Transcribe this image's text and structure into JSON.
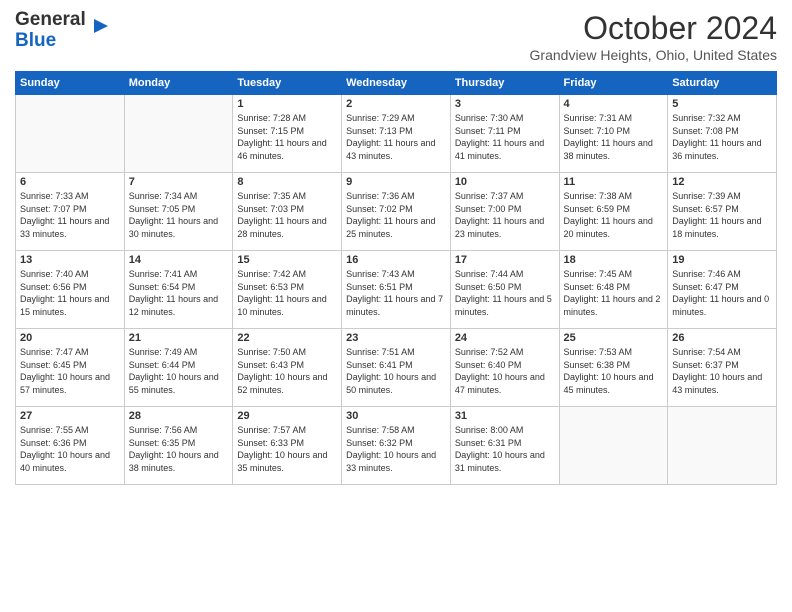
{
  "header": {
    "logo_line1": "General",
    "logo_line2": "Blue",
    "month_title": "October 2024",
    "location": "Grandview Heights, Ohio, United States"
  },
  "weekdays": [
    "Sunday",
    "Monday",
    "Tuesday",
    "Wednesday",
    "Thursday",
    "Friday",
    "Saturday"
  ],
  "weeks": [
    [
      {
        "day": "",
        "sunrise": "",
        "sunset": "",
        "daylight": ""
      },
      {
        "day": "",
        "sunrise": "",
        "sunset": "",
        "daylight": ""
      },
      {
        "day": "1",
        "sunrise": "Sunrise: 7:28 AM",
        "sunset": "Sunset: 7:15 PM",
        "daylight": "Daylight: 11 hours and 46 minutes."
      },
      {
        "day": "2",
        "sunrise": "Sunrise: 7:29 AM",
        "sunset": "Sunset: 7:13 PM",
        "daylight": "Daylight: 11 hours and 43 minutes."
      },
      {
        "day": "3",
        "sunrise": "Sunrise: 7:30 AM",
        "sunset": "Sunset: 7:11 PM",
        "daylight": "Daylight: 11 hours and 41 minutes."
      },
      {
        "day": "4",
        "sunrise": "Sunrise: 7:31 AM",
        "sunset": "Sunset: 7:10 PM",
        "daylight": "Daylight: 11 hours and 38 minutes."
      },
      {
        "day": "5",
        "sunrise": "Sunrise: 7:32 AM",
        "sunset": "Sunset: 7:08 PM",
        "daylight": "Daylight: 11 hours and 36 minutes."
      }
    ],
    [
      {
        "day": "6",
        "sunrise": "Sunrise: 7:33 AM",
        "sunset": "Sunset: 7:07 PM",
        "daylight": "Daylight: 11 hours and 33 minutes."
      },
      {
        "day": "7",
        "sunrise": "Sunrise: 7:34 AM",
        "sunset": "Sunset: 7:05 PM",
        "daylight": "Daylight: 11 hours and 30 minutes."
      },
      {
        "day": "8",
        "sunrise": "Sunrise: 7:35 AM",
        "sunset": "Sunset: 7:03 PM",
        "daylight": "Daylight: 11 hours and 28 minutes."
      },
      {
        "day": "9",
        "sunrise": "Sunrise: 7:36 AM",
        "sunset": "Sunset: 7:02 PM",
        "daylight": "Daylight: 11 hours and 25 minutes."
      },
      {
        "day": "10",
        "sunrise": "Sunrise: 7:37 AM",
        "sunset": "Sunset: 7:00 PM",
        "daylight": "Daylight: 11 hours and 23 minutes."
      },
      {
        "day": "11",
        "sunrise": "Sunrise: 7:38 AM",
        "sunset": "Sunset: 6:59 PM",
        "daylight": "Daylight: 11 hours and 20 minutes."
      },
      {
        "day": "12",
        "sunrise": "Sunrise: 7:39 AM",
        "sunset": "Sunset: 6:57 PM",
        "daylight": "Daylight: 11 hours and 18 minutes."
      }
    ],
    [
      {
        "day": "13",
        "sunrise": "Sunrise: 7:40 AM",
        "sunset": "Sunset: 6:56 PM",
        "daylight": "Daylight: 11 hours and 15 minutes."
      },
      {
        "day": "14",
        "sunrise": "Sunrise: 7:41 AM",
        "sunset": "Sunset: 6:54 PM",
        "daylight": "Daylight: 11 hours and 12 minutes."
      },
      {
        "day": "15",
        "sunrise": "Sunrise: 7:42 AM",
        "sunset": "Sunset: 6:53 PM",
        "daylight": "Daylight: 11 hours and 10 minutes."
      },
      {
        "day": "16",
        "sunrise": "Sunrise: 7:43 AM",
        "sunset": "Sunset: 6:51 PM",
        "daylight": "Daylight: 11 hours and 7 minutes."
      },
      {
        "day": "17",
        "sunrise": "Sunrise: 7:44 AM",
        "sunset": "Sunset: 6:50 PM",
        "daylight": "Daylight: 11 hours and 5 minutes."
      },
      {
        "day": "18",
        "sunrise": "Sunrise: 7:45 AM",
        "sunset": "Sunset: 6:48 PM",
        "daylight": "Daylight: 11 hours and 2 minutes."
      },
      {
        "day": "19",
        "sunrise": "Sunrise: 7:46 AM",
        "sunset": "Sunset: 6:47 PM",
        "daylight": "Daylight: 11 hours and 0 minutes."
      }
    ],
    [
      {
        "day": "20",
        "sunrise": "Sunrise: 7:47 AM",
        "sunset": "Sunset: 6:45 PM",
        "daylight": "Daylight: 10 hours and 57 minutes."
      },
      {
        "day": "21",
        "sunrise": "Sunrise: 7:49 AM",
        "sunset": "Sunset: 6:44 PM",
        "daylight": "Daylight: 10 hours and 55 minutes."
      },
      {
        "day": "22",
        "sunrise": "Sunrise: 7:50 AM",
        "sunset": "Sunset: 6:43 PM",
        "daylight": "Daylight: 10 hours and 52 minutes."
      },
      {
        "day": "23",
        "sunrise": "Sunrise: 7:51 AM",
        "sunset": "Sunset: 6:41 PM",
        "daylight": "Daylight: 10 hours and 50 minutes."
      },
      {
        "day": "24",
        "sunrise": "Sunrise: 7:52 AM",
        "sunset": "Sunset: 6:40 PM",
        "daylight": "Daylight: 10 hours and 47 minutes."
      },
      {
        "day": "25",
        "sunrise": "Sunrise: 7:53 AM",
        "sunset": "Sunset: 6:38 PM",
        "daylight": "Daylight: 10 hours and 45 minutes."
      },
      {
        "day": "26",
        "sunrise": "Sunrise: 7:54 AM",
        "sunset": "Sunset: 6:37 PM",
        "daylight": "Daylight: 10 hours and 43 minutes."
      }
    ],
    [
      {
        "day": "27",
        "sunrise": "Sunrise: 7:55 AM",
        "sunset": "Sunset: 6:36 PM",
        "daylight": "Daylight: 10 hours and 40 minutes."
      },
      {
        "day": "28",
        "sunrise": "Sunrise: 7:56 AM",
        "sunset": "Sunset: 6:35 PM",
        "daylight": "Daylight: 10 hours and 38 minutes."
      },
      {
        "day": "29",
        "sunrise": "Sunrise: 7:57 AM",
        "sunset": "Sunset: 6:33 PM",
        "daylight": "Daylight: 10 hours and 35 minutes."
      },
      {
        "day": "30",
        "sunrise": "Sunrise: 7:58 AM",
        "sunset": "Sunset: 6:32 PM",
        "daylight": "Daylight: 10 hours and 33 minutes."
      },
      {
        "day": "31",
        "sunrise": "Sunrise: 8:00 AM",
        "sunset": "Sunset: 6:31 PM",
        "daylight": "Daylight: 10 hours and 31 minutes."
      },
      {
        "day": "",
        "sunrise": "",
        "sunset": "",
        "daylight": ""
      },
      {
        "day": "",
        "sunrise": "",
        "sunset": "",
        "daylight": ""
      }
    ]
  ]
}
